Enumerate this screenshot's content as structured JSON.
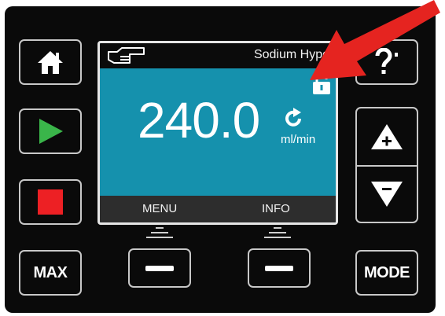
{
  "screen": {
    "fluid_name": "Sodium Hypo",
    "flow_value": "240.0",
    "flow_unit": "ml/min",
    "softkey_left": "MENU",
    "softkey_right": "INFO",
    "status_icons": [
      "manual-hand-icon",
      "unlocked-padlock-icon",
      "rotation-direction-icon"
    ]
  },
  "keys": {
    "home": "home-icon",
    "run": "play-icon",
    "stop": "stop-icon",
    "max_label": "MAX",
    "mode_label": "MODE",
    "increase": "plus-arrow-icon",
    "decrease": "minus-arrow-icon"
  },
  "colors": {
    "panel": "#0a0a0a",
    "screen_bg": "#1591ad",
    "run_green": "#3ab54a",
    "stop_red": "#ed2024",
    "pointer_arrow": "#e52420"
  }
}
